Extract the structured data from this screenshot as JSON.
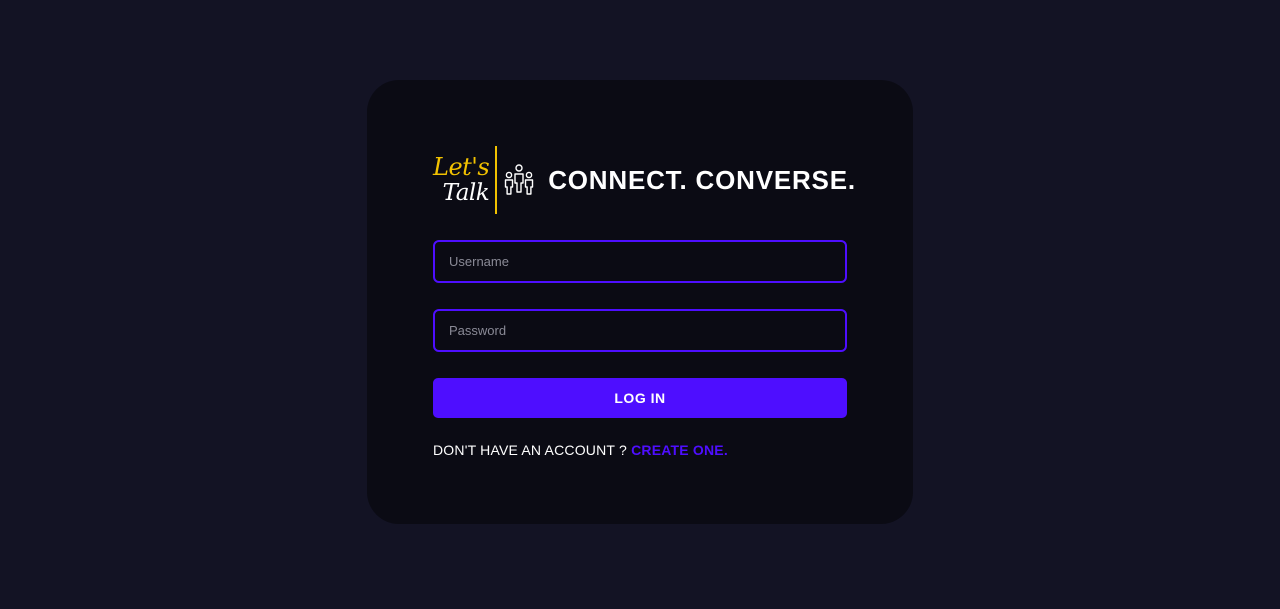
{
  "brand": {
    "logo_line1": "Let's",
    "logo_line2": "Talk",
    "tagline": "CONNECT. CONVERSE.",
    "icon": "people-group-icon"
  },
  "form": {
    "username_placeholder": "Username",
    "password_placeholder": "Password",
    "login_label": "LOG IN"
  },
  "signup": {
    "prompt": "DON'T HAVE AN ACCOUNT ? ",
    "link_label": "CREATE ONE."
  },
  "colors": {
    "background": "#131324",
    "card": "#0b0b14",
    "accent": "#4e0eff",
    "logo_gold": "#f2c200"
  }
}
